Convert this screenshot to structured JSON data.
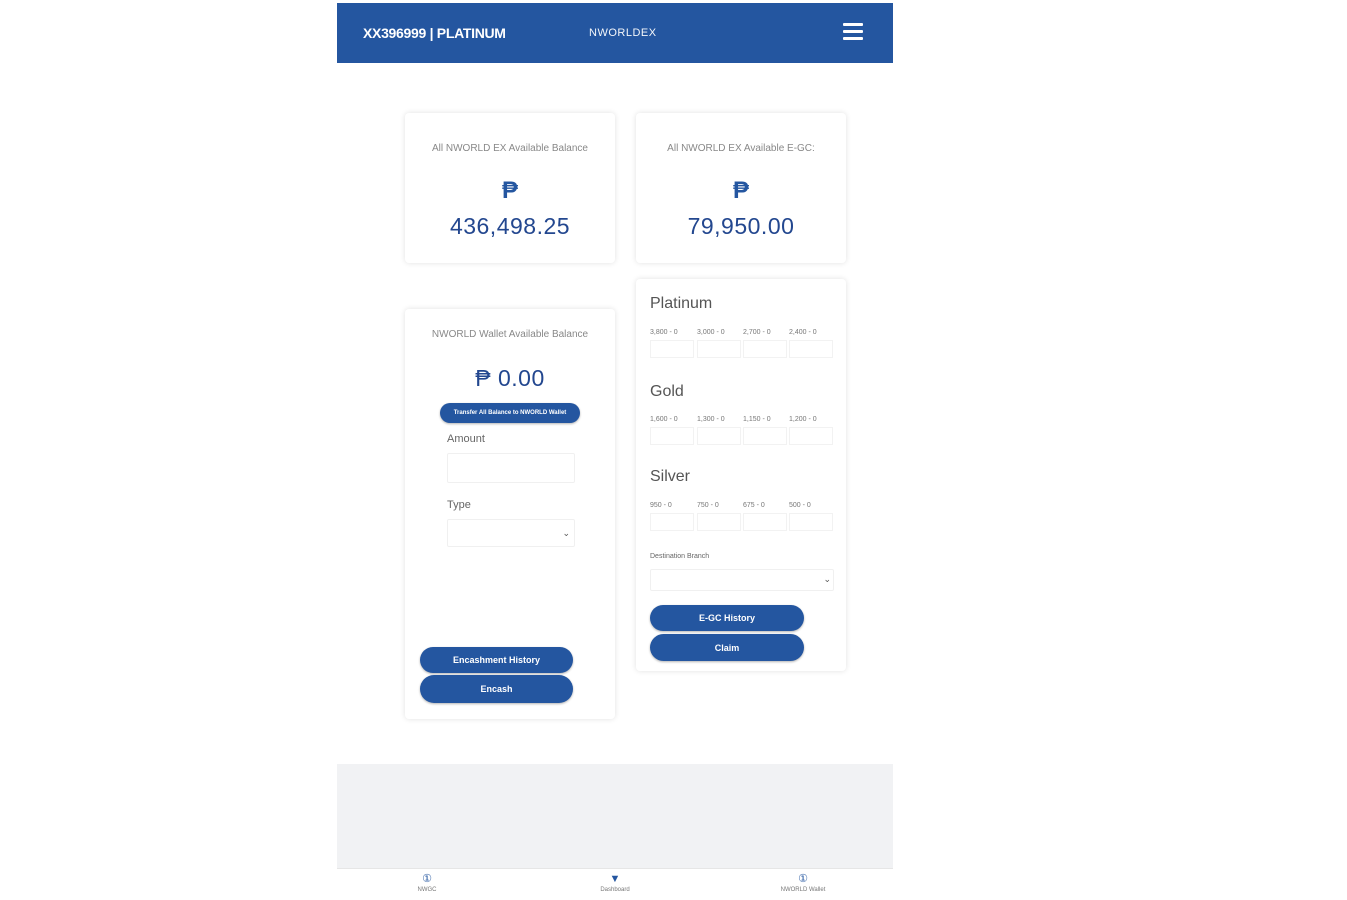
{
  "header": {
    "account": "XX396999 | PLATINUM",
    "brand": "NWORLDEX"
  },
  "balance_cards": [
    {
      "label": "All NWORLD EX Available Balance",
      "currency": "₱",
      "amount": "436,498.25"
    },
    {
      "label": "All NWORLD EX Available E-GC:",
      "currency": "₱",
      "amount": "79,950.00"
    }
  ],
  "wallet": {
    "label": "NWORLD Wallet Available Balance",
    "amount": "₱ 0.00",
    "transfer_button": "Transfer All Balance to NWORLD Wallet",
    "amount_label": "Amount",
    "type_label": "Type",
    "history_button": "Encashment History",
    "encash_button": "Encash"
  },
  "egc": {
    "tiers": [
      {
        "name": "Platinum",
        "denoms": [
          "3,800 - 0",
          "3,000 - 0",
          "2,700 - 0",
          "2,400 - 0"
        ]
      },
      {
        "name": "Gold",
        "denoms": [
          "1,600 - 0",
          "1,300 - 0",
          "1,150 - 0",
          "1,200 - 0"
        ]
      },
      {
        "name": "Silver",
        "denoms": [
          "950 - 0",
          "750 - 0",
          "675 - 0",
          "500 - 0"
        ]
      }
    ],
    "destination_label": "Destination Branch",
    "history_button": "E-GC History",
    "claim_button": "Claim"
  },
  "bottom_nav": [
    {
      "icon": "①",
      "label": "NWGC"
    },
    {
      "icon": "▼",
      "label": "Dashboard"
    },
    {
      "icon": "①",
      "label": "NWORLD Wallet"
    }
  ],
  "colors": {
    "primary": "#2456a0",
    "footer": "#f1f2f4"
  }
}
